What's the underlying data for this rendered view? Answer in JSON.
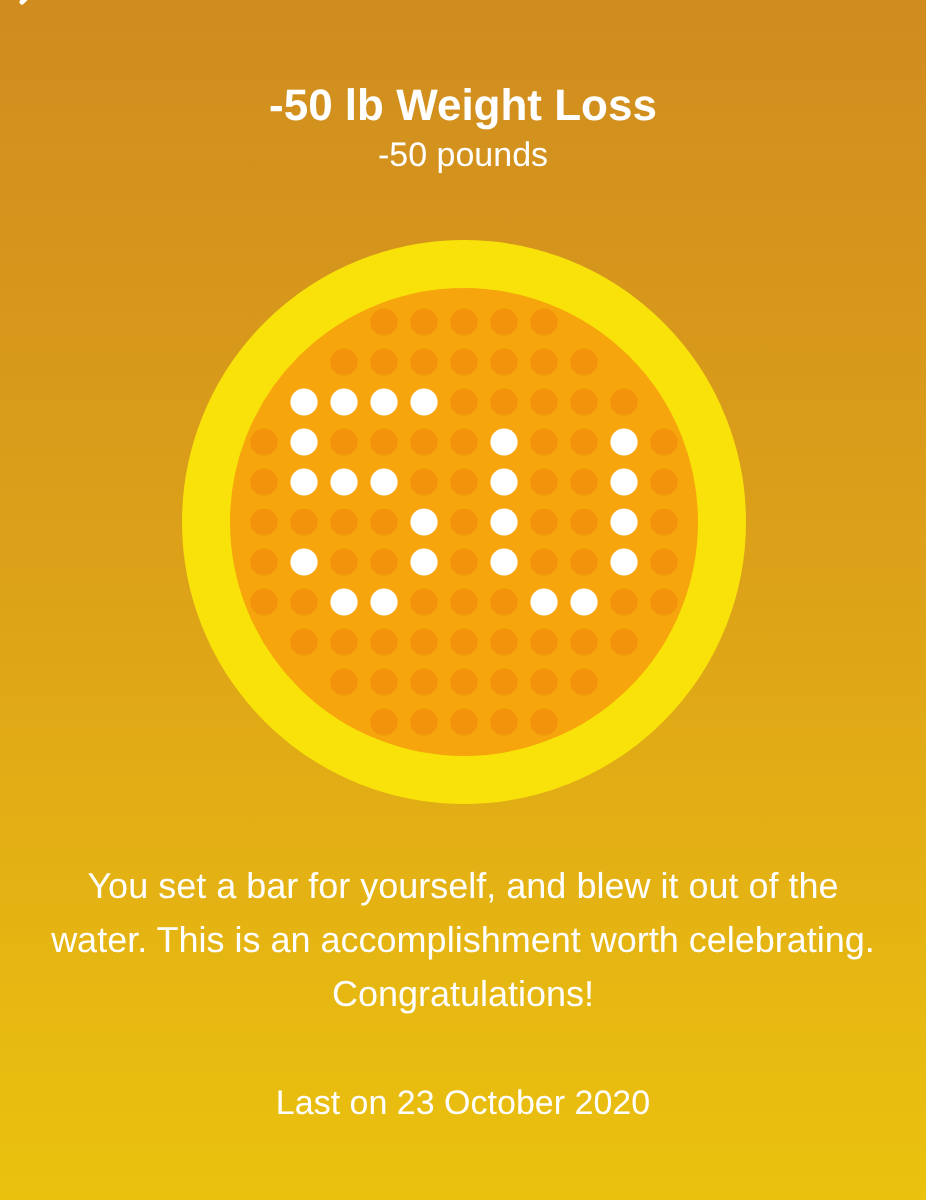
{
  "title": "-50 lb Weight Loss",
  "subtitle": "-50 pounds",
  "message": "You set a bar for yourself, and blew it out of the water. This is an accomplishment worth celebrating. Congratulations!",
  "last_earned": "Last on 23 October 2020"
}
